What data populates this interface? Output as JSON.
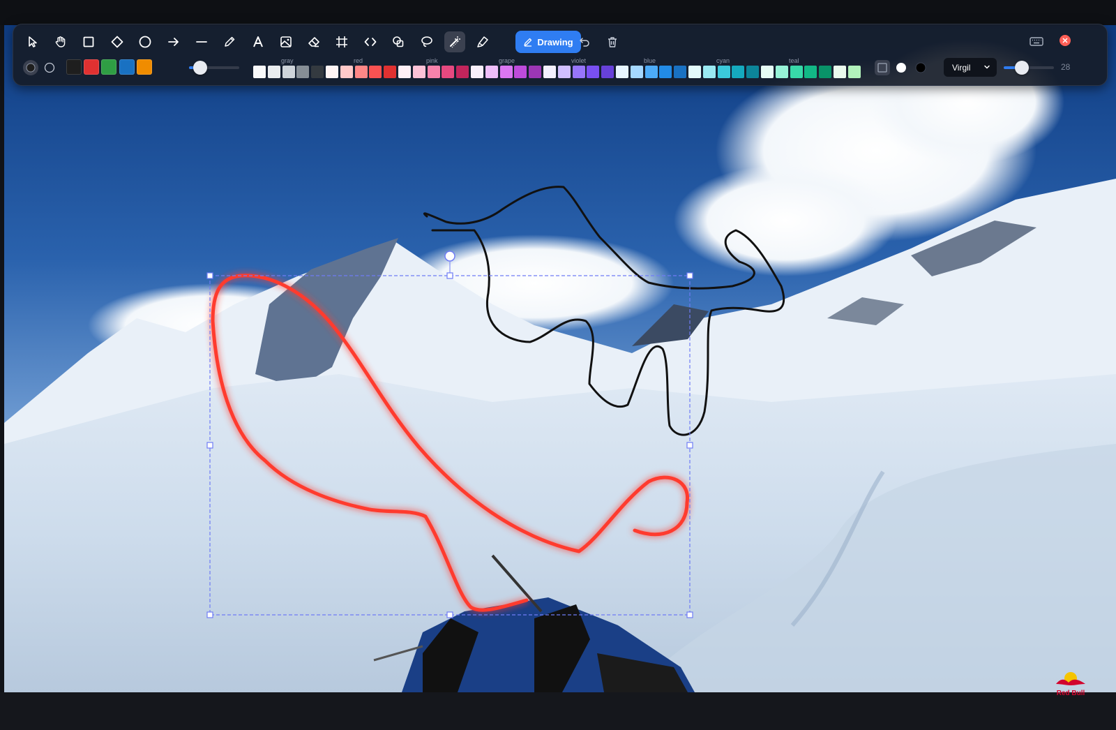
{
  "toolbar": {
    "tools": [
      {
        "name": "select",
        "icon": "cursor-arrow-icon",
        "active": false
      },
      {
        "name": "hand",
        "icon": "hand-icon",
        "active": false
      },
      {
        "name": "rectangle",
        "icon": "square-icon",
        "active": false
      },
      {
        "name": "diamond",
        "icon": "diamond-icon",
        "active": false
      },
      {
        "name": "ellipse",
        "icon": "circle-icon",
        "active": false
      },
      {
        "name": "arrow",
        "icon": "arrow-right-icon",
        "active": false
      },
      {
        "name": "line",
        "icon": "line-icon",
        "active": false
      },
      {
        "name": "pencil",
        "icon": "pencil-icon",
        "active": false
      },
      {
        "name": "text",
        "icon": "text-a-icon",
        "active": false
      },
      {
        "name": "image",
        "icon": "image-icon",
        "active": false
      },
      {
        "name": "eraser",
        "icon": "eraser-icon",
        "active": false
      },
      {
        "name": "frame",
        "icon": "frame-hash-icon",
        "active": false
      },
      {
        "name": "embed",
        "icon": "code-brackets-icon",
        "active": false
      },
      {
        "name": "shapes",
        "icon": "shapes-icon",
        "active": false
      },
      {
        "name": "lasso",
        "icon": "lasso-icon",
        "active": false
      },
      {
        "name": "laser",
        "icon": "laser-wand-icon",
        "active": true
      },
      {
        "name": "highlighter",
        "icon": "highlighter-icon",
        "active": false
      }
    ],
    "drawing_label": "Drawing",
    "palette_groups": [
      "gray",
      "red",
      "pink",
      "grape",
      "violet",
      "blue",
      "cyan",
      "teal"
    ],
    "font": "Virgil",
    "stroke_size": "28"
  },
  "colors": {
    "accent": "#2f7df2",
    "quick_colors": [
      "#1e1e1e",
      "#e03131",
      "#2f9e44",
      "#1971c2",
      "#f08c00"
    ],
    "palette": {
      "gray": [
        "#f8f9fa",
        "#e9ecef",
        "#ced4da",
        "#868e96",
        "#343a40"
      ],
      "red": [
        "#fff5f5",
        "#ffc9c9",
        "#ff8787",
        "#fa5252",
        "#e03131"
      ],
      "pink": [
        "#fff0f6",
        "#fcc2d7",
        "#f783ac",
        "#e64980",
        "#c2255c"
      ],
      "grape": [
        "#f8f0fc",
        "#eebefa",
        "#da77f2",
        "#be4bdb",
        "#9c36b5"
      ],
      "violet": [
        "#f3f0ff",
        "#d0bfff",
        "#9775fa",
        "#7950f2",
        "#6741d9"
      ],
      "blue": [
        "#e7f5ff",
        "#a5d8ff",
        "#4dabf7",
        "#228be6",
        "#1971c2"
      ],
      "cyan": [
        "#e3fafc",
        "#99e9f2",
        "#3bc9db",
        "#15aabf",
        "#0c8599"
      ],
      "teal": [
        "#e6fcf5",
        "#96f2d7",
        "#38d9a9",
        "#12b886",
        "#099268"
      ],
      "green": [
        "#ebfbee",
        "#b2f2bb"
      ]
    },
    "red_stroke": "#ff3b2f",
    "black_stroke": "#111111",
    "selection": "#6f7cf5"
  },
  "watermark": "Red Bull"
}
